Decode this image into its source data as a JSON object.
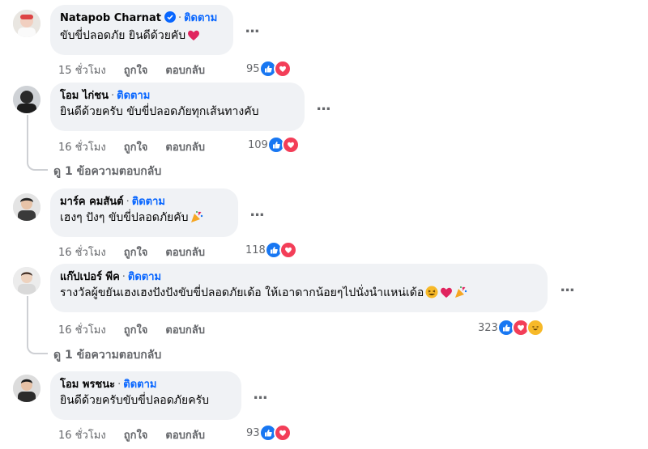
{
  "comments": [
    {
      "name": "Natapob Charnat",
      "follow": "ติดตาม",
      "text": "ขับขี่ปลอดภัย ยินดีด้วยคับ",
      "time": "15 ชั่วโมง",
      "like_label": "ถูกใจ",
      "reply_label": "ตอบกลับ",
      "reaction_count": "95",
      "reactions": [
        "like-icon",
        "love-icon"
      ],
      "verified": true,
      "trailing_emoji": "heart-icon"
    },
    {
      "name": "โอม ไก่ชน",
      "follow": "ติดตาม",
      "text": "ยินดีด้วยครับ ขับขี่ปลอดภัยทุกเส้นทางคับ",
      "time": "16 ชั่วโมง",
      "like_label": "ถูกใจ",
      "reply_label": "ตอบกลับ",
      "reaction_count": "109",
      "reactions": [
        "like-icon",
        "love-icon"
      ],
      "view_replies": "ดู 1 ข้อความตอบกลับ"
    },
    {
      "name": "มาร์ค คมสันต์",
      "follow": "ติดตาม",
      "text": "เฮงๆ ปังๆ ขับขี่ปลอดภัยคับ",
      "time": "16 ชั่วโมง",
      "like_label": "ถูกใจ",
      "reply_label": "ตอบกลับ",
      "reaction_count": "118",
      "reactions": [
        "like-icon",
        "love-icon"
      ],
      "trailing_emoji": "party-popper-icon"
    },
    {
      "name": "แก๊ปเปอร์ พีค",
      "follow": "ติดตาม",
      "text": "รางวัลผู้ขยันเฮงเฮงปังปังขับขี่ปลอดภัยเด้อ ให้เอาดากน้อยๆไปนั่งนำแหน่เด้อ",
      "time": "16 ชั่วโมง",
      "like_label": "ถูกใจ",
      "reply_label": "ตอบกลับ",
      "reaction_count": "323",
      "reactions": [
        "like-icon",
        "love-icon",
        "haha-icon"
      ],
      "trailing_emoji": "laughing-heart-party-icons",
      "view_replies": "ดู 1 ข้อความตอบกลับ"
    },
    {
      "name": "โอม พรชนะ",
      "follow": "ติดตาม",
      "text": "ยินดีด้วยครับขับขี่ปลอดภัยครับ",
      "time": "16 ชั่วโมง",
      "like_label": "ถูกใจ",
      "reply_label": "ตอบกลับ",
      "reaction_count": "93",
      "reactions": [
        "like-icon",
        "love-icon"
      ]
    }
  ],
  "more_label": "...",
  "colors": {
    "bubble": "#f0f2f5",
    "follow": "#0866ff",
    "meta": "#65676b",
    "like": "#1877f2",
    "love": "#f33e58"
  }
}
